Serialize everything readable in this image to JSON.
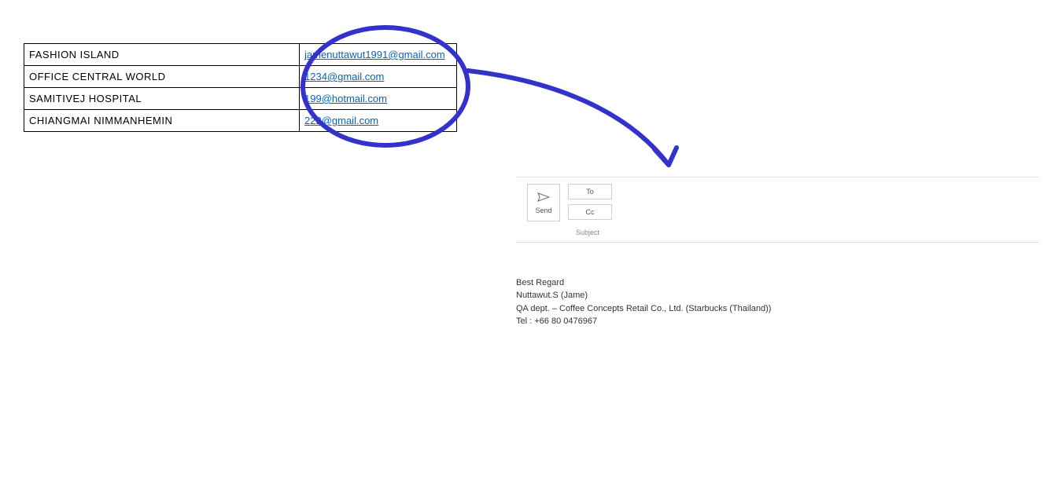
{
  "table": {
    "rows": [
      {
        "name": "FASHION ISLAND",
        "email": "jamenuttawut1991@gmail.com"
      },
      {
        "name": "OFFICE CENTRAL WORLD",
        "email": "1234@gmail.com"
      },
      {
        "name": "SAMITIVEJ HOSPITAL",
        "email": "199@hotmail.com"
      },
      {
        "name": "CHIANGMAI NIMMANHEMIN",
        "email": "222@gmail.com"
      }
    ]
  },
  "compose": {
    "send_label": "Send",
    "to_label": "To",
    "cc_label": "Cc",
    "subject_label": "Subject",
    "to_value": "",
    "cc_value": "",
    "subject_value": ""
  },
  "signature": {
    "line1": "Best Regard",
    "line2": "Nuttawut.S (Jame)",
    "line3": "QA dept. – Coffee Concepts Retail Co., Ltd. (Starbucks (Thailand))",
    "line4": "Tel : +66 80 0476967"
  },
  "annotation": {
    "stroke_color": "#3333cc"
  }
}
